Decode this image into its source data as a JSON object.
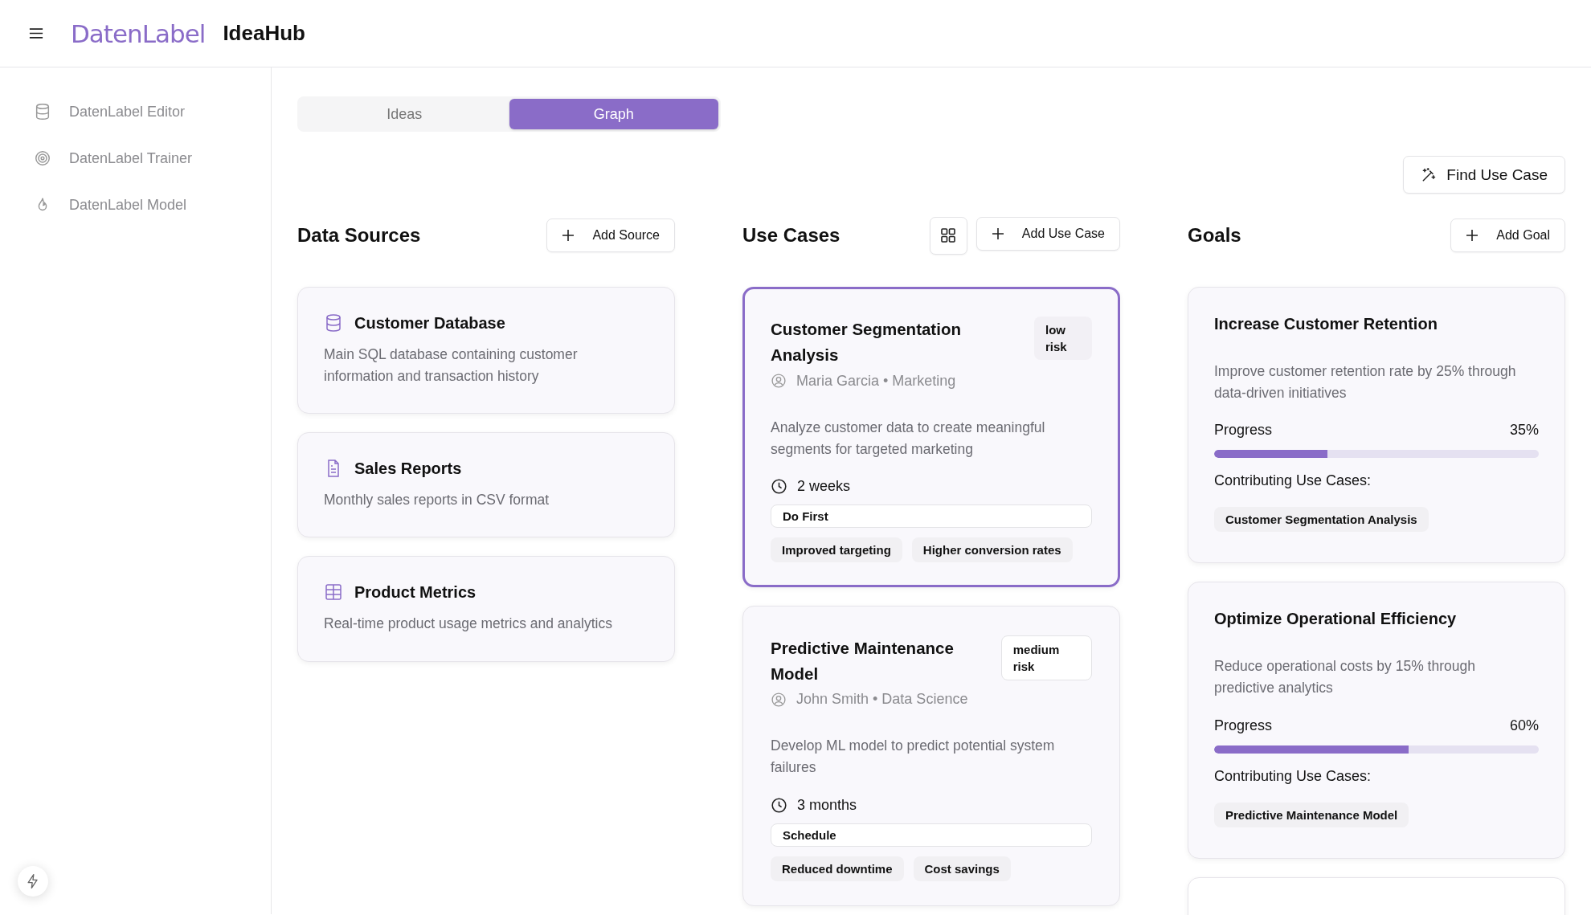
{
  "header": {
    "brand": "DatenLabel",
    "app_name": "IdeaHub"
  },
  "sidebar": {
    "items": [
      {
        "label": "DatenLabel Editor",
        "kind": "database"
      },
      {
        "label": "DatenLabel Trainer",
        "kind": "target"
      },
      {
        "label": "DatenLabel Model",
        "kind": "flame"
      }
    ]
  },
  "tabs": [
    {
      "label": "Ideas",
      "selected": false
    },
    {
      "label": "Graph",
      "selected": true
    }
  ],
  "find_button": "Find Use Case",
  "data_sources": {
    "title": "Data Sources",
    "add_button": "Add Source",
    "items": [
      {
        "name": "Customer Database",
        "kind": "database",
        "description": "Main SQL database containing customer information and transaction history"
      },
      {
        "name": "Sales Reports",
        "kind": "document",
        "description": "Monthly sales reports in CSV format"
      },
      {
        "name": "Product Metrics",
        "kind": "table",
        "description": "Real-time product usage metrics and analytics"
      }
    ]
  },
  "use_cases": {
    "title": "Use Cases",
    "add_button": "Add Use Case",
    "items": [
      {
        "title": "Customer Segmentation Analysis",
        "selected": true,
        "risk": {
          "label": "low risk",
          "kind": "low"
        },
        "owner": "Maria Garcia • Marketing",
        "description": "Analyze customer data to create meaningful segments for targeted marketing",
        "duration": "2 weeks",
        "priority": "Do First",
        "benefits": [
          "Improved targeting",
          "Higher conversion rates"
        ]
      },
      {
        "title": "Predictive Maintenance Model",
        "selected": false,
        "risk": {
          "label": "medium risk",
          "kind": "medium"
        },
        "owner": "John Smith • Data Science",
        "description": "Develop ML model to predict potential system failures",
        "duration": "3 months",
        "priority": "Schedule",
        "benefits": [
          "Reduced downtime",
          "Cost savings"
        ]
      }
    ]
  },
  "goals": {
    "title": "Goals",
    "add_button": "Add Goal",
    "items": [
      {
        "title": "Increase Customer Retention",
        "description": "Improve customer retention rate by 25% through data-driven initiatives",
        "progress_label": "Progress",
        "progress_value": "35%",
        "level": 0.35,
        "contributing_label": "Contributing Use Cases:",
        "use_cases": [
          "Customer Segmentation Analysis"
        ]
      },
      {
        "title": "Optimize Operational Efficiency",
        "description": "Reduce operational costs by 15% through predictive analytics",
        "progress_label": "Progress",
        "progress_value": "60%",
        "level": 0.6,
        "contributing_label": "Contributing Use Cases:",
        "use_cases": [
          "Predictive Maintenance Model"
        ]
      }
    ]
  }
}
